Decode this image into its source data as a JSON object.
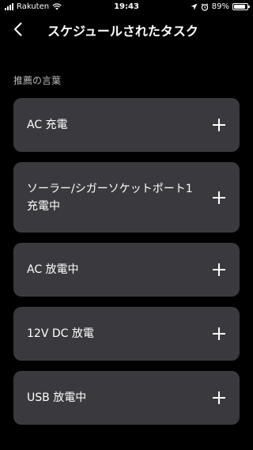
{
  "status_bar": {
    "carrier": "Rakuten",
    "time": "19:43",
    "battery_percent": "89%",
    "battery_level": 0.89
  },
  "header": {
    "back_icon": "chevron-left-icon",
    "title": "スケジュールされたタスク"
  },
  "section": {
    "label": "推薦の言葉"
  },
  "tasks": [
    {
      "label": "AC 充電",
      "icon": "plus-icon"
    },
    {
      "label": "ソーラー/シガーソケットポート1 充電中",
      "icon": "plus-icon"
    },
    {
      "label": "AC 放電中",
      "icon": "plus-icon"
    },
    {
      "label": "12V DC 放電",
      "icon": "plus-icon"
    },
    {
      "label": "USB 放電中",
      "icon": "plus-icon"
    }
  ]
}
